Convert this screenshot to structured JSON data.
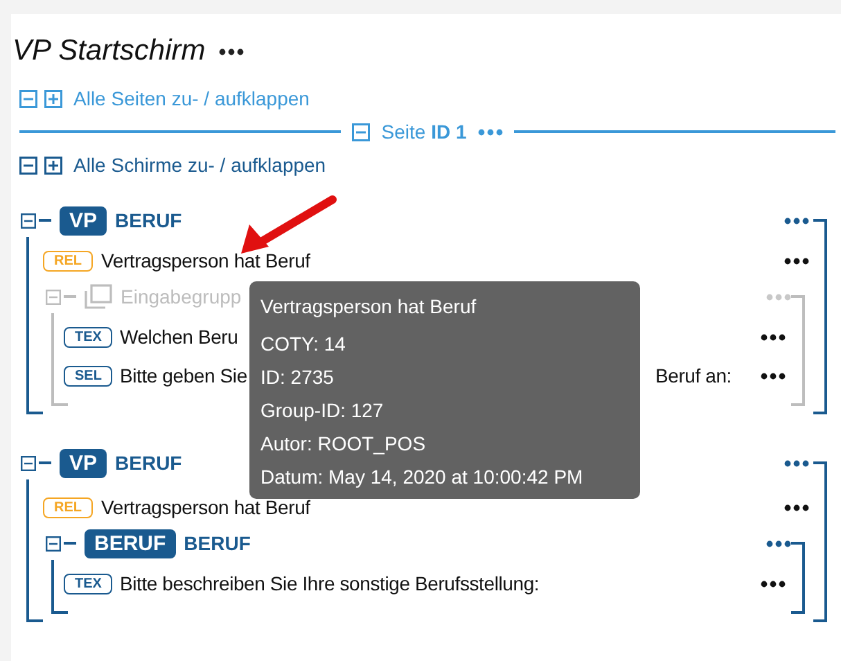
{
  "title": "VP Startschirm",
  "toggle_pages": {
    "label": "Alle Seiten zu- / aufklappen"
  },
  "page": {
    "label": "Seite **ID 1**"
  },
  "toggle_screens": {
    "label": "Alle Schirme zu- / aufklappen"
  },
  "groups": [
    {
      "badge": "VP",
      "title": "BERUF",
      "items": [
        {
          "kind": "row",
          "tag": "REL",
          "color": "#f5a623",
          "text": "Vertragsperson hat Beruf"
        },
        {
          "kind": "input-group",
          "disabled": true,
          "label": "Eingabegrupp",
          "items": [
            {
              "kind": "row",
              "tag": "TEX",
              "color": "#1a5a8f",
              "text": "Welchen Beru"
            },
            {
              "kind": "row",
              "tag": "SEL",
              "color": "#1a5a8f",
              "text": "Bitte geben Sie",
              "text_end": "Beruf an:"
            }
          ]
        }
      ]
    },
    {
      "badge": "VP",
      "title": "BERUF",
      "items": [
        {
          "kind": "row",
          "tag": "REL",
          "color": "#f5a623",
          "text": "Vertragsperson hat Beruf"
        },
        {
          "kind": "entity-group",
          "disabled": false,
          "badge": "BERUF",
          "title": "BERUF",
          "items": [
            {
              "kind": "row",
              "tag": "TEX",
              "color": "#1a5a8f",
              "text": "Bitte beschreiben Sie Ihre sonstige Berufsstellung:"
            }
          ]
        }
      ]
    }
  ],
  "tooltip": {
    "title": "Vertragsperson hat Beruf",
    "lines": [
      "COTY: 14",
      "ID: 2735",
      "Group-ID: 127",
      "Autor: ROOT_POS",
      "Datum: May 14, 2020 at 10:00:42 PM"
    ]
  }
}
